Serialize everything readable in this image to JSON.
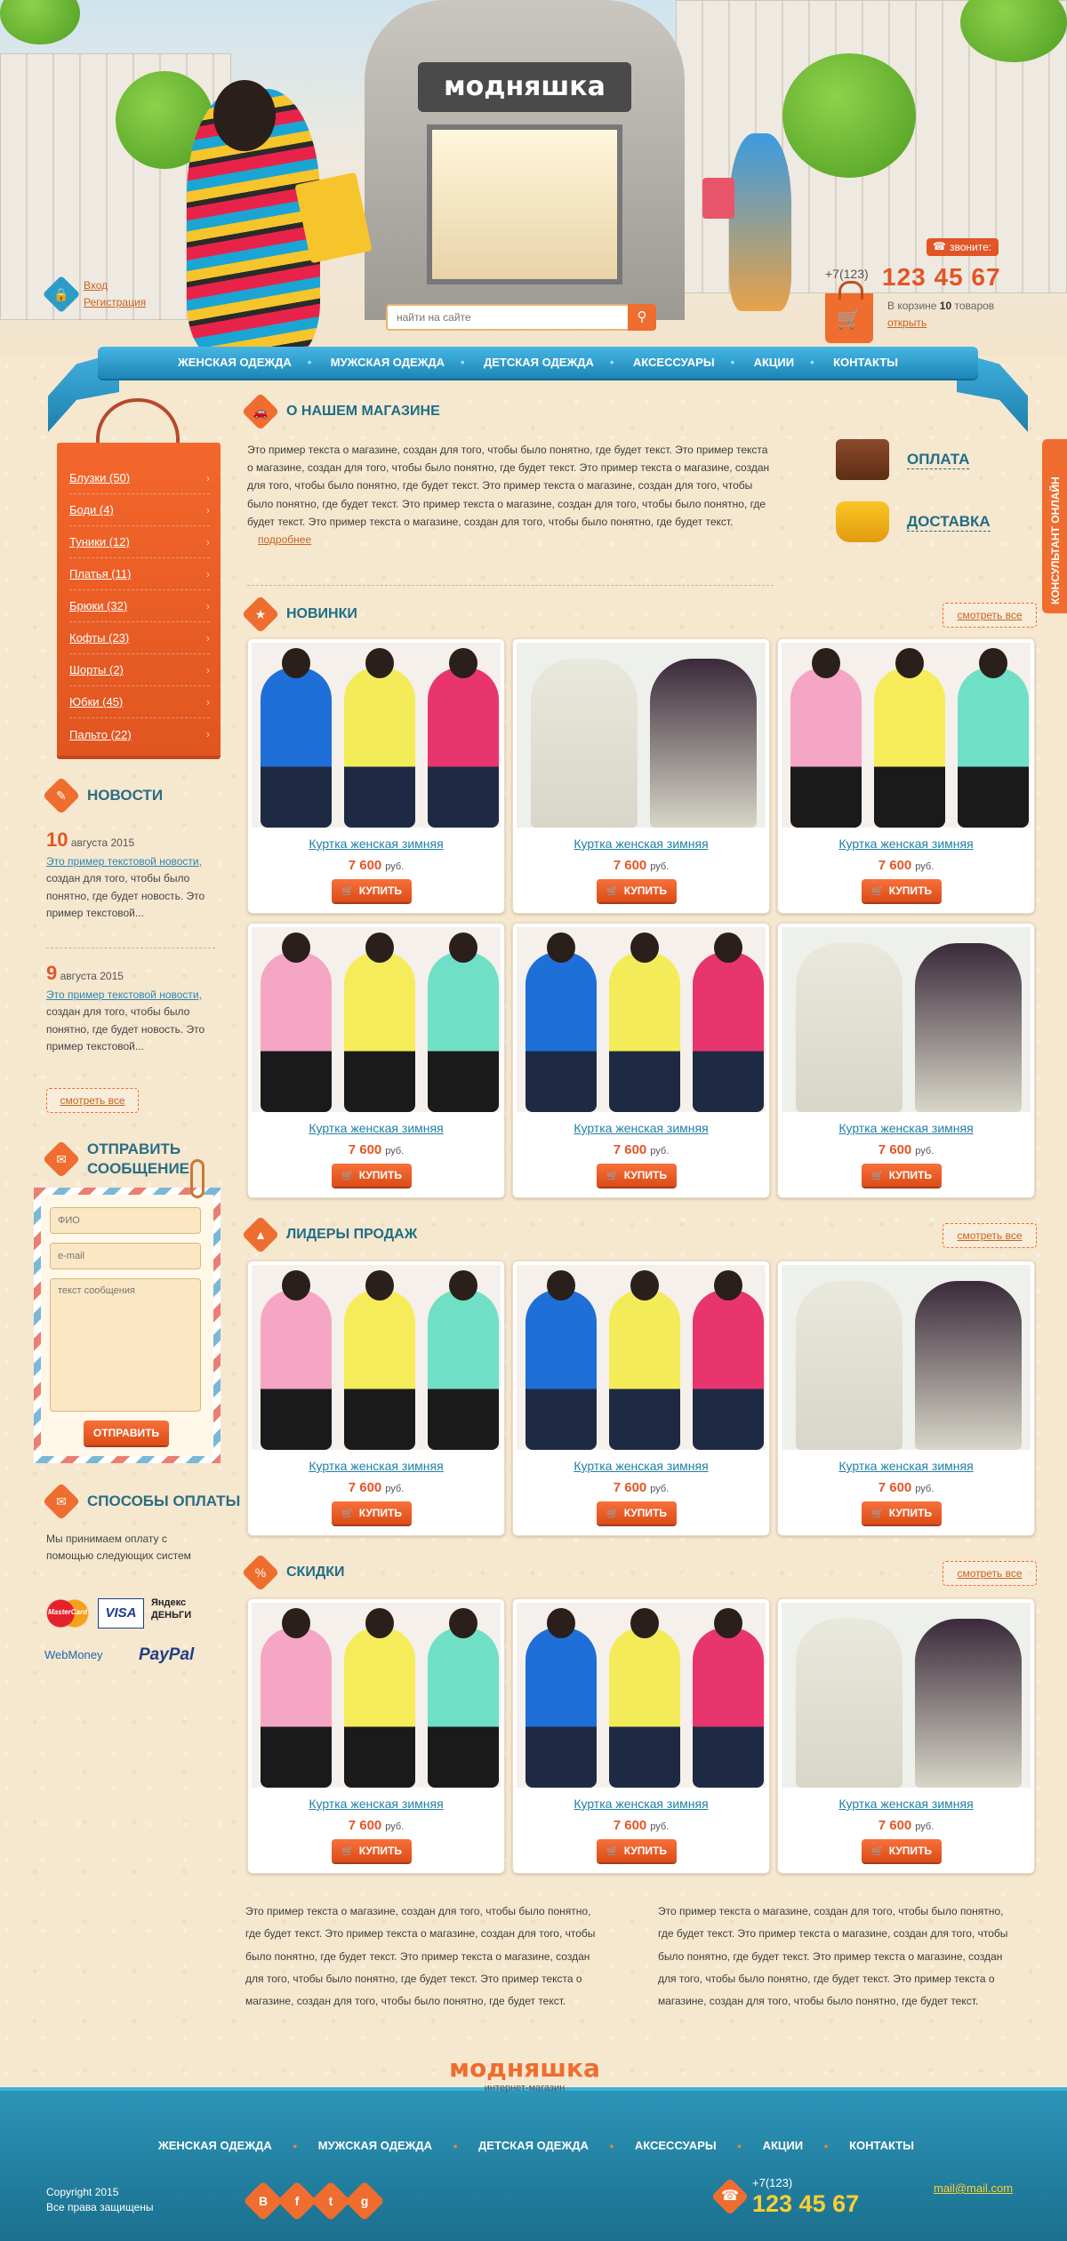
{
  "header": {
    "store_sign": "модняшка",
    "login": "Вход",
    "register": "Регистрация",
    "search_placeholder": "найти на сайте",
    "call_label": "звоните:",
    "phone_prefix": "+7(123)",
    "phone_number": "123 45 67",
    "cart_text_before": "В корзине",
    "cart_count": "10",
    "cart_text_after": "товаров",
    "cart_open": "открыть"
  },
  "nav": [
    "ЖЕНСКАЯ ОДЕЖДА",
    "МУЖСКАЯ ОДЕЖДА",
    "ДЕТСКАЯ ОДЕЖДА",
    "АКСЕССУАРЫ",
    "АКЦИИ",
    "КОНТАКТЫ"
  ],
  "categories": [
    {
      "label": "Блузки (50)"
    },
    {
      "label": "Боди (4)"
    },
    {
      "label": "Туники (12)"
    },
    {
      "label": "Платья (11)"
    },
    {
      "label": "Брюки (32)"
    },
    {
      "label": "Кофты (23)"
    },
    {
      "label": "Шорты (2)"
    },
    {
      "label": "Юбки (45)"
    },
    {
      "label": "Пальто (22)"
    }
  ],
  "news": {
    "title": "НОВОСТИ",
    "items": [
      {
        "day": "10",
        "month": "августа 2015",
        "link": "Это пример текстовой новости,",
        "text": "создан для того, чтобы было понятно, где будет новость. Это пример текстовой..."
      },
      {
        "day": "9",
        "month": "августа 2015",
        "link": "Это пример текстовой новости,",
        "text": "создан для того, чтобы было понятно, где будет новость. Это пример текстовой..."
      }
    ],
    "see_all": "смотреть все"
  },
  "message_form": {
    "title_line1": "ОТПРАВИТЬ",
    "title_line2": "СООБЩЕНИЕ",
    "name_placeholder": "ФИО",
    "email_placeholder": "e-mail",
    "message_placeholder": "текст сообщения",
    "submit": "ОТПРАВИТЬ"
  },
  "payment": {
    "title": "СПОСОБЫ ОПЛАТЫ",
    "text": "Мы принимаем оплату с помощью следующих систем",
    "logos": [
      "MasterCard",
      "VISA",
      "Яндекс ДЕНЬГИ",
      "WebMoney",
      "PayPal"
    ]
  },
  "about": {
    "title": "О НАШЕМ МАГАЗИНЕ",
    "text": "Это пример текста о магазине, создан для того, чтобы было понятно, где будет текст. Это пример текста о магазине, создан для того, чтобы было понятно, где будет текст. Это пример текста о магазине, создан для того, чтобы было понятно, где будет текст. Это пример текста о магазине, создан для того, чтобы было понятно, где будет текст. Это пример текста о магазине, создан для того, чтобы было понятно, где будет текст. Это пример текста о магазине, создан для того, чтобы было понятно, где будет текст.",
    "more": "подробнее",
    "payment_link": "ОПЛАТА",
    "delivery_link": "ДОСТАВКА"
  },
  "sections": {
    "new": "НОВИНКИ",
    "leaders": "ЛИДЕРЫ ПРОДАЖ",
    "discounts": "СКИДКИ",
    "see_all": "смотреть все"
  },
  "product": {
    "name": "Куртка женская зимняя",
    "price": "7 600",
    "currency": "руб.",
    "buy": "КУПИТЬ"
  },
  "bottom_text_left": "Это пример текста о магазине, создан для того, чтобы было понятно, где будет текст. Это пример текста о магазине, создан для того, чтобы было понятно, где будет текст. Это пример текста о магазине, создан для того, чтобы было понятно, где будет текст. Это пример текста о магазине, создан для того, чтобы было понятно, где будет текст.",
  "bottom_text_right": "Это пример текста о магазине, создан для того, чтобы было понятно, где будет текст. Это пример текста о магазине, создан для того, чтобы было понятно, где будет текст. Это пример текста о магазине, создан для того, чтобы было понятно, где будет текст. Это пример текста о магазине, создан для того, чтобы было понятно, где будет текст.",
  "footer": {
    "brand": "модняшка",
    "subtitle": "интернет-магазин",
    "nav": [
      "ЖЕНСКАЯ ОДЕЖДА",
      "МУЖСКАЯ ОДЕЖДА",
      "ДЕТСКАЯ ОДЕЖДА",
      "АКСЕССУАРЫ",
      "АКЦИИ",
      "КОНТАКТЫ"
    ],
    "copyright": "Copyright 2015",
    "rights": "Все права защищены",
    "social": [
      "В",
      "f",
      "t",
      "g"
    ],
    "phone_prefix": "+7(123)",
    "phone_number": "123 45 67",
    "email": "mail@mail.com"
  },
  "consultant": "КОНСУЛЬТАНТ ОНЛАЙН",
  "colors": {
    "accent": "#ef6d2e",
    "nav": "#2a9ccb",
    "heading": "#1f6e85"
  }
}
